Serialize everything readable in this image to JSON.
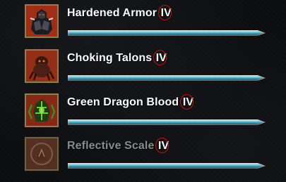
{
  "skills": [
    {
      "name": "Hardened Armor",
      "rank": "IV",
      "icon": "armored-knight-icon",
      "xp_fill": 1.0,
      "faded": false
    },
    {
      "name": "Choking Talons",
      "rank": "IV",
      "icon": "talons-creature-icon",
      "xp_fill": 1.0,
      "faded": false
    },
    {
      "name": "Green Dragon Blood",
      "rank": "IV",
      "icon": "dragon-blood-icon",
      "xp_fill": 1.0,
      "faded": false
    },
    {
      "name": "Reflective Scale",
      "rank": "IV",
      "icon": "reflective-scale-icon",
      "xp_fill": 1.0,
      "faded": true
    }
  ],
  "colors": {
    "rank_highlight": "#cc1111",
    "xp_bar_fill": "#4fb6c9",
    "xp_bar_frame": "#b9bcc0",
    "icon_border": "#8f7d57"
  }
}
